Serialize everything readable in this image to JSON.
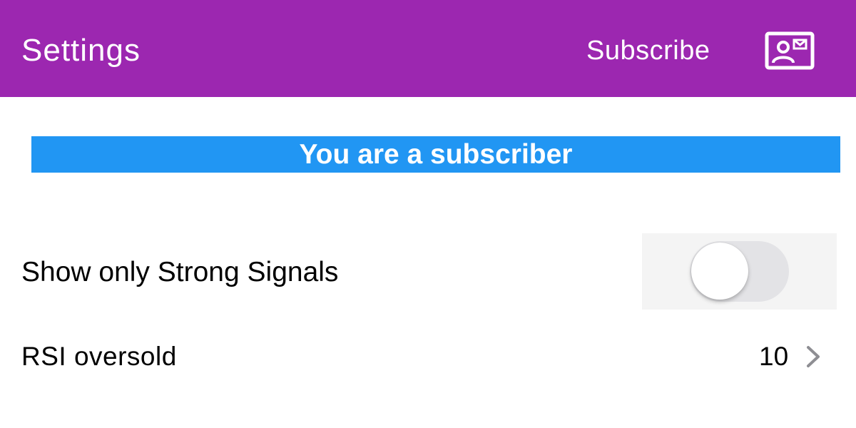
{
  "navbar": {
    "title": "Settings",
    "subscribe_label": "Subscribe",
    "profile_icon": "profile-card-icon",
    "background_color": "#9c27b0"
  },
  "banner": {
    "text": "You are a subscriber",
    "background_color": "#2196f3"
  },
  "settings": {
    "strong_signals": {
      "label": "Show only Strong Signals",
      "enabled": false
    },
    "rsi_oversold": {
      "label": "RSI oversold",
      "value": "10",
      "icon": "chevron-right-icon"
    }
  }
}
